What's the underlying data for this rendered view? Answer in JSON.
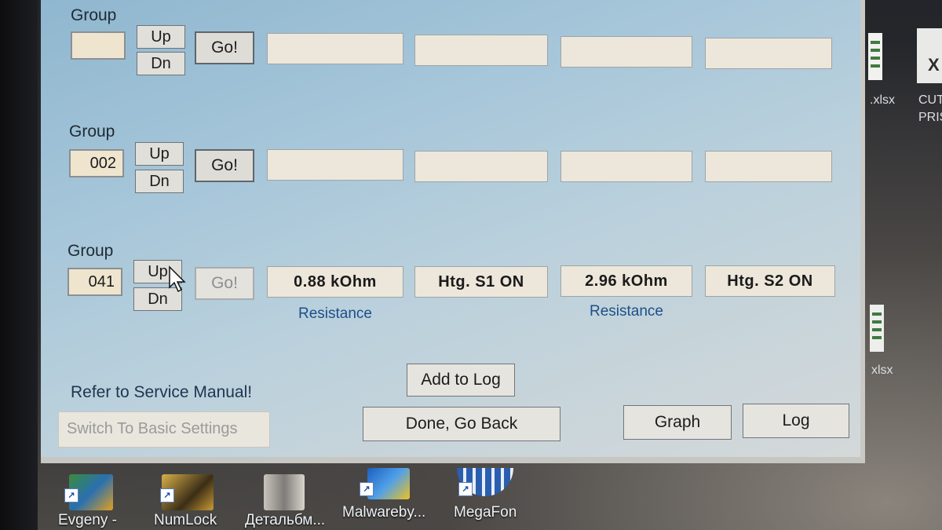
{
  "groups": [
    {
      "label": "Group",
      "value": "",
      "up": "Up",
      "dn": "Dn",
      "go": "Go!",
      "fields": [
        "",
        "",
        "",
        ""
      ]
    },
    {
      "label": "Group",
      "value": "002",
      "up": "Up",
      "dn": "Dn",
      "go": "Go!",
      "fields": [
        "",
        "",
        "",
        ""
      ]
    },
    {
      "label": "Group",
      "value": "041",
      "up": "Up",
      "dn": "Dn",
      "go": "Go!",
      "fields": [
        "0.88 kOhm",
        "Htg. S1 ON",
        "2.96 kOhm",
        "Htg. S2 ON"
      ],
      "captions": [
        "Resistance",
        "Resistance"
      ]
    }
  ],
  "buttons": {
    "add_to_log": "Add to Log",
    "done_go_back": "Done, Go Back",
    "graph": "Graph",
    "log": "Log",
    "switch_basic": "Switch To Basic Settings"
  },
  "note": "Refer to Service Manual!",
  "desktop": {
    "icons": [
      {
        "label": "Evgeny -",
        "icon": "app-shortcut-icon"
      },
      {
        "label": "NumLock",
        "icon": "numlock-shortcut-icon"
      },
      {
        "label": "Детальбм...",
        "icon": "folder-shortcut-icon"
      },
      {
        "label": "Malwareby...",
        "icon": "malwarebytes-shortcut-icon"
      },
      {
        "label": "MegaFon",
        "icon": "megafon-shortcut-icon"
      }
    ],
    "side": {
      "file1": ".xlsx",
      "file2_top": "CUT",
      "file2_bottom": "PRIS",
      "file3": "xlsx"
    }
  }
}
